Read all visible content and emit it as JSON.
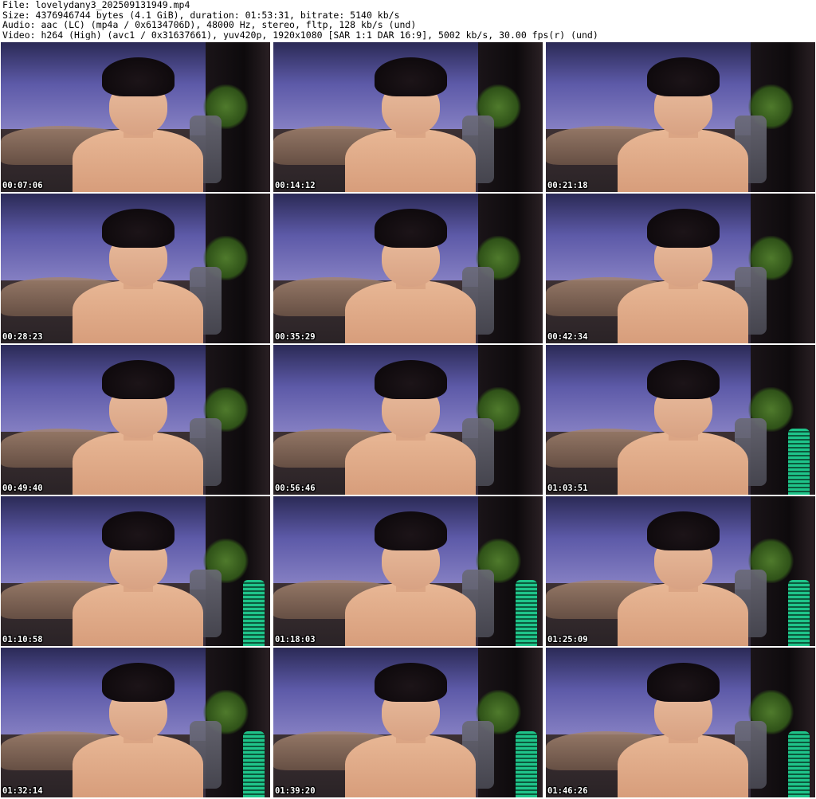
{
  "header": {
    "file_line": "File: lovelydany3_202509131949.mp4",
    "size_line": "Size: 4376946744 bytes (4.1 GiB), duration: 01:53:31, bitrate: 5140 kb/s",
    "audio_line": "Audio: aac (LC) (mp4a / 0x6134706D), 48000 Hz, stereo, fltp, 128 kb/s (und)",
    "video_line": "Video: h264 (High) (avc1 / 0x31637661), yuv420p, 1920x1080 [SAR 1:1 DAR 16:9], 5002 kb/s, 30.00 fps(r) (und)"
  },
  "thumbnails": [
    {
      "timestamp": "00:07:06",
      "mic_visible": false
    },
    {
      "timestamp": "00:14:12",
      "mic_visible": false
    },
    {
      "timestamp": "00:21:18",
      "mic_visible": false
    },
    {
      "timestamp": "00:28:23",
      "mic_visible": false
    },
    {
      "timestamp": "00:35:29",
      "mic_visible": false
    },
    {
      "timestamp": "00:42:34",
      "mic_visible": false
    },
    {
      "timestamp": "00:49:40",
      "mic_visible": false
    },
    {
      "timestamp": "00:56:46",
      "mic_visible": false
    },
    {
      "timestamp": "01:03:51",
      "mic_visible": true
    },
    {
      "timestamp": "01:10:58",
      "mic_visible": true
    },
    {
      "timestamp": "01:18:03",
      "mic_visible": true
    },
    {
      "timestamp": "01:25:09",
      "mic_visible": true
    },
    {
      "timestamp": "01:32:14",
      "mic_visible": true
    },
    {
      "timestamp": "01:39:20",
      "mic_visible": true
    },
    {
      "timestamp": "01:46:26",
      "mic_visible": true
    }
  ]
}
